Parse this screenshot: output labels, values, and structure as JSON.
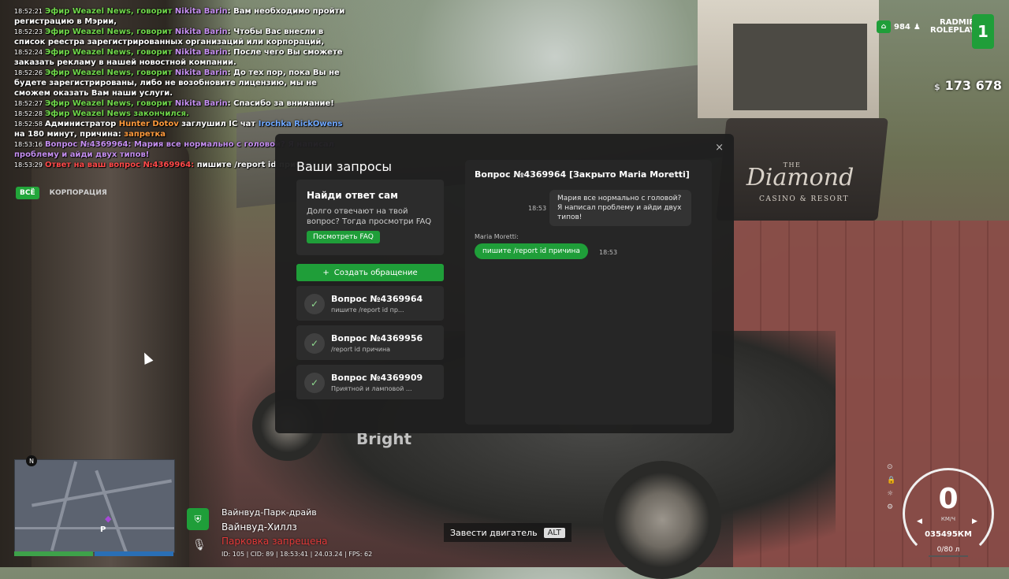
{
  "chat": {
    "lines": [
      {
        "ts": "18:52:21",
        "parts": [
          [
            "c-green",
            "Эфир Weazel News, говорит "
          ],
          [
            "c-purple",
            "Nikita Barin"
          ],
          [
            "c-white",
            ": Вам необходимо пройти регистрацию в Мэрии,"
          ]
        ]
      },
      {
        "ts": "18:52:23",
        "parts": [
          [
            "c-green",
            "Эфир Weazel News, говорит "
          ],
          [
            "c-purple",
            "Nikita Barin"
          ],
          [
            "c-white",
            ": Чтобы Вас внесли в список реестра зарегистрированных организаций или корпораций,"
          ]
        ]
      },
      {
        "ts": "18:52:24",
        "parts": [
          [
            "c-green",
            "Эфир Weazel News, говорит "
          ],
          [
            "c-purple",
            "Nikita Barin"
          ],
          [
            "c-white",
            ": После чего Вы сможете заказать рекламу в нашей новостной компании."
          ]
        ]
      },
      {
        "ts": "18:52:26",
        "parts": [
          [
            "c-green",
            "Эфир Weazel News, говорит "
          ],
          [
            "c-purple",
            "Nikita Barin"
          ],
          [
            "c-white",
            ": До тех пор, пока Вы не будете зарегистрированы, либо не возобновите лицензию, мы не сможем оказать Вам наши услуги."
          ]
        ]
      },
      {
        "ts": "18:52:27",
        "parts": [
          [
            "c-green",
            "Эфир Weazel News, говорит "
          ],
          [
            "c-purple",
            "Nikita Barin"
          ],
          [
            "c-white",
            ": Спасибо за внимание!"
          ]
        ]
      },
      {
        "ts": "18:52:28",
        "parts": [
          [
            "c-green",
            "Эфир Weazel News закончился."
          ]
        ]
      },
      {
        "ts": "18:52:58",
        "parts": [
          [
            "c-white",
            "Администратор "
          ],
          [
            "c-orange",
            "Hunter Dotov"
          ],
          [
            "c-white",
            " заглушил IC чат "
          ],
          [
            "c-blue",
            "Irochka RickOwens"
          ],
          [
            "c-white",
            " на 180 минут, причина: "
          ],
          [
            "c-orange",
            "запретка"
          ]
        ]
      },
      {
        "ts": "18:53:16",
        "parts": [
          [
            "c-purple",
            "Вопрос №4369964: Мария все нормально с головой? Я написал проблему и айди двух типов!"
          ]
        ]
      },
      {
        "ts": "18:53:29",
        "parts": [
          [
            "c-red",
            "Ответ на ваш вопрос №4369964: "
          ],
          [
            "c-white",
            "пишите /report id причина"
          ]
        ]
      }
    ],
    "tabs": [
      "ВСЁ",
      "КОРПОРАЦИЯ"
    ]
  },
  "modal": {
    "title": "Ваши запросы",
    "close": "×",
    "faq": {
      "title": "Найди ответ сам",
      "desc": "Долго отвечают на твой вопрос? Тогда просмотри FAQ",
      "button": "Посмотреть FAQ"
    },
    "create_button": "Создать обращение",
    "create_icon": "+",
    "requests": [
      {
        "title": "Вопрос №4369964",
        "sub": "пишите /report id пр..."
      },
      {
        "title": "Вопрос №4369956",
        "sub": "/report id причина"
      },
      {
        "title": "Вопрос №4369909",
        "sub": "Приятной и ламповой ..."
      }
    ],
    "conversation": {
      "title": "Вопрос №4369964 [Закрыто Maria Moretti]",
      "incoming_text": "Мария все нормально с головой? Я написал проблему и айди двух типов!",
      "incoming_time": "18:53",
      "author": "Maria Moretti:",
      "outgoing_text": "пишите /report id причина",
      "outgoing_time": "18:53"
    }
  },
  "hud": {
    "online": "984",
    "brand_line1": "RADMIR",
    "brand_line2": "ROLEPLAY",
    "server_num": "1",
    "money_symbol": "$",
    "money": "173 678",
    "location_street": "Вайнвуд-Парк-драйв",
    "location_district": "Вайнвуд-Хиллз",
    "parking": "Парковка запрещена",
    "info": "ID: 105 | CID: 89 | 18:53:41 | 24.03.24 | FPS: 62",
    "engine_hint": "Завести двигатель",
    "engine_key": "ALT",
    "speed": "0",
    "speed_unit": "КМ/Ч",
    "odometer": "035495КМ",
    "fuel": "0/80 л",
    "minimap_north": "N",
    "minimap_p": "P",
    "sign_main": "Diamond",
    "sign_top": "THE",
    "sign_sub": "CASINO & RESORT",
    "car_logo": "Bright"
  },
  "colors": {
    "accent": "#1f9e39",
    "panel": "#1e1e1e",
    "card": "#2c2c2c"
  }
}
